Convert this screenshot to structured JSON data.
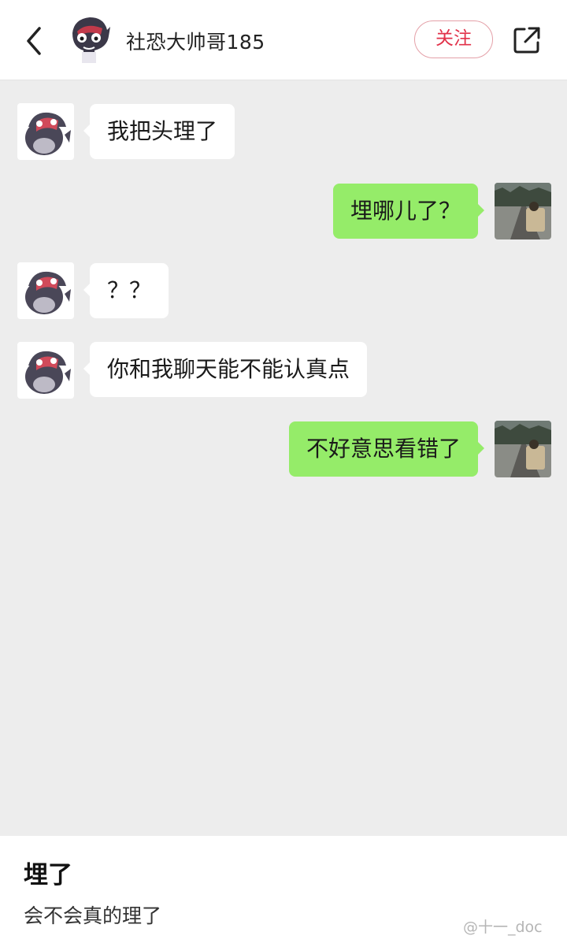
{
  "header": {
    "username": "社恐大帅哥185",
    "follow_label": "关注"
  },
  "messages": [
    {
      "side": "left",
      "text": "我把头理了"
    },
    {
      "side": "right",
      "text": "埋哪儿了？"
    },
    {
      "side": "left",
      "text": "？？"
    },
    {
      "side": "left",
      "text": "你和我聊天能不能认真点"
    },
    {
      "side": "right",
      "text": "不好意思看错了"
    }
  ],
  "caption": {
    "title": "埋了",
    "body": "会不会真的理了"
  },
  "watermark": "@十一_doc",
  "colors": {
    "incoming_bubble": "#ffffff",
    "outgoing_bubble": "#95ec69",
    "follow_accent": "#e1324a",
    "chat_background": "#ededed"
  },
  "icons": {
    "back": "chevron-left-icon",
    "share": "share-external-icon"
  }
}
